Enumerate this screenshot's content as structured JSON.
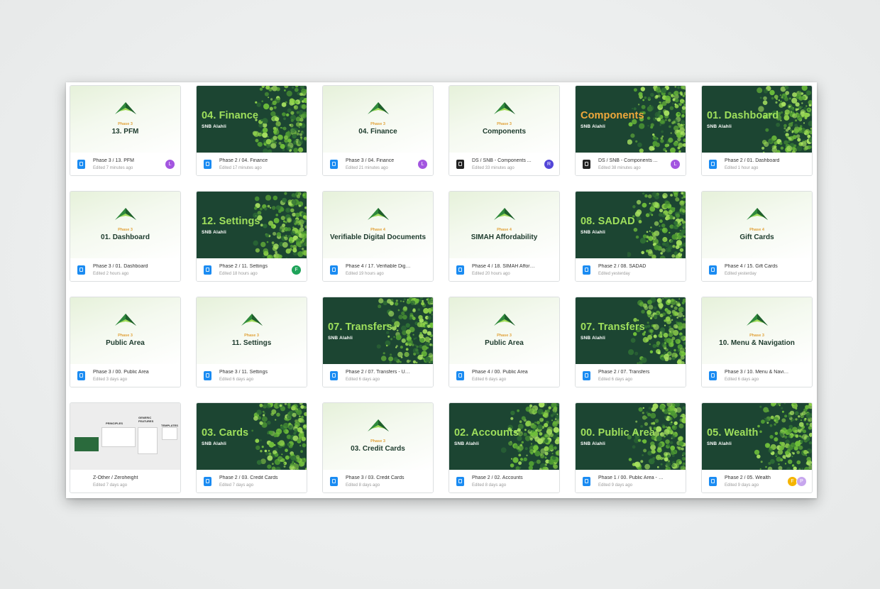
{
  "colors": {
    "dark_bg": "#1c4532",
    "accent_green": "#9fe05c",
    "accent_orange": "#f2a93b",
    "phase_label": "#e1a23a",
    "file_icon_blue": "#1a8bf2"
  },
  "files": [
    {
      "thumb": "light",
      "phase": "Phase 3",
      "title": "13. PFM",
      "name": "Phase 3 / 13. PFM",
      "edited": "Edited 7 minutes ago",
      "icon": "figma-file-icon",
      "icon_color": "blue",
      "avatars": [
        {
          "letter": "L",
          "color": "#a355e0"
        }
      ]
    },
    {
      "thumb": "dark",
      "title": "04. Finance",
      "brand": "SNB Alahli",
      "name": "Phase 2 / 04. Finance",
      "edited": "Edited 17 minutes ago",
      "icon": "figma-file-icon",
      "icon_color": "blue",
      "avatars": []
    },
    {
      "thumb": "light",
      "phase": "Phase 3",
      "title": "04. Finance",
      "name": "Phase 3 / 04. Finance",
      "edited": "Edited 21 minutes ago",
      "icon": "figma-file-icon",
      "icon_color": "blue",
      "avatars": [
        {
          "letter": "L",
          "color": "#a355e0"
        }
      ]
    },
    {
      "thumb": "light",
      "phase": "Phase 3",
      "title": "Components",
      "name": "DS / SNB - Components ...",
      "edited": "Edited 33 minutes ago",
      "icon": "library-file-icon",
      "icon_color": "black",
      "avatars": [
        {
          "letter": "R",
          "color": "#5346d8"
        }
      ]
    },
    {
      "thumb": "dark",
      "title": "Components",
      "title_color": "orange",
      "brand": "SNB Alahli",
      "name": "DS / SNB - Components ...",
      "edited": "Edited 38 minutes ago",
      "icon": "library-file-icon",
      "icon_color": "black",
      "avatars": [
        {
          "letter": "L",
          "color": "#a355e0"
        }
      ]
    },
    {
      "thumb": "dark",
      "title": "01. Dashboard",
      "brand": "SNB Alahli",
      "name": "Phase 2 / 01. Dashboard",
      "edited": "Edited 1 hour ago",
      "icon": "figma-file-icon",
      "icon_color": "blue",
      "avatars": []
    },
    {
      "thumb": "light",
      "phase": "Phase 3",
      "title": "01. Dashboard",
      "name": "Phase 3 / 01. Dashboard",
      "edited": "Edited 2 hours ago",
      "icon": "figma-file-icon",
      "icon_color": "blue",
      "avatars": []
    },
    {
      "thumb": "dark",
      "title": "12. Settings",
      "brand": "SNB Alahli",
      "name": "Phase 2 / 11. Settings",
      "edited": "Edited 18 hours ago",
      "icon": "figma-file-icon",
      "icon_color": "blue",
      "avatars": [
        {
          "letter": "F",
          "color": "#1fa35a"
        }
      ]
    },
    {
      "thumb": "light",
      "phase": "Phase 4",
      "title": "Verifiable Digital Documents",
      "name": "Phase 4 / 17. Verifiable Digital ...",
      "edited": "Edited 19 hours ago",
      "icon": "figma-file-icon",
      "icon_color": "blue",
      "avatars": []
    },
    {
      "thumb": "light",
      "phase": "Phase 4",
      "title": "SIMAH Affordability",
      "name": "Phase 4 / 18. SIMAH Affordab...",
      "edited": "Edited 20 hours ago",
      "icon": "figma-file-icon",
      "icon_color": "blue",
      "avatars": []
    },
    {
      "thumb": "dark",
      "title": "08. SADAD",
      "brand": "SNB Alahli",
      "name": "Phase 2 / 08. SADAD",
      "edited": "Edited yesterday",
      "icon": "figma-file-icon",
      "icon_color": "blue",
      "avatars": []
    },
    {
      "thumb": "light",
      "phase": "Phase 4",
      "title": "Gift Cards",
      "name": "Phase 4 / 15. Gift Cards",
      "edited": "Edited yesterday",
      "icon": "figma-file-icon",
      "icon_color": "blue",
      "avatars": []
    },
    {
      "thumb": "light",
      "phase": "Phase 3",
      "title": "Public Area",
      "name": "Phase 3 / 00. Public Area",
      "edited": "Edited 3 days ago",
      "icon": "figma-file-icon",
      "icon_color": "blue",
      "avatars": []
    },
    {
      "thumb": "light",
      "phase": "Phase 3",
      "title": "11. Settings",
      "name": "Phase 3 / 11. Settings",
      "edited": "Edited 6 days ago",
      "icon": "figma-file-icon",
      "icon_color": "blue",
      "avatars": []
    },
    {
      "thumb": "dark",
      "title": "07. Transfers",
      "brand": "SNB Alahli",
      "name": "Phase 2 / 07. Transfers - Upd...",
      "edited": "Edited 6 days ago",
      "icon": "figma-file-icon",
      "icon_color": "blue",
      "avatars": []
    },
    {
      "thumb": "light",
      "phase": "Phase 3",
      "title": "Public Area",
      "name": "Phase 4 / 00. Public Area",
      "edited": "Edited 6 days ago",
      "icon": "figma-file-icon",
      "icon_color": "blue",
      "avatars": []
    },
    {
      "thumb": "dark",
      "title": "07. Transfers",
      "brand": "SNB Alahli",
      "name": "Phase 2 / 07. Transfers",
      "edited": "Edited 6 days ago",
      "icon": "figma-file-icon",
      "icon_color": "blue",
      "avatars": []
    },
    {
      "thumb": "light",
      "phase": "Phase 3",
      "title": "10. Menu & Navigation",
      "name": "Phase 3 / 10. Menu & Navigati...",
      "edited": "Edited 6 days ago",
      "icon": "figma-file-icon",
      "icon_color": "blue",
      "avatars": []
    },
    {
      "thumb": "other",
      "zo_labels": [
        "PRINCIPLES",
        "GENERIC FEATURES",
        "TEMPLATES"
      ],
      "name": "Z-Other / Zeroheight",
      "edited": "Edited 7 days ago",
      "icon": "none",
      "icon_color": "none",
      "avatars": []
    },
    {
      "thumb": "dark",
      "title": "03. Cards",
      "brand": "SNB Alahli",
      "name": "Phase 2 / 03. Credit Cards",
      "edited": "Edited 7 days ago",
      "icon": "figma-file-icon",
      "icon_color": "blue",
      "avatars": []
    },
    {
      "thumb": "light",
      "phase": "Phase 3",
      "title": "03. Credit Cards",
      "name": "Phase 3 / 03. Credit Cards",
      "edited": "Edited 8 days ago",
      "icon": "figma-file-icon",
      "icon_color": "blue",
      "avatars": []
    },
    {
      "thumb": "dark",
      "title": "02. Accounts",
      "brand": "SNB Alahli",
      "name": "Phase 2 / 02. Accounts",
      "edited": "Edited 8 days ago",
      "icon": "figma-file-icon",
      "icon_color": "blue",
      "avatars": []
    },
    {
      "thumb": "dark",
      "title": "00. Public Area",
      "brand": "SNB Alahli",
      "name": "Phase 1 / 00. Public Area - Up...",
      "edited": "Edited 9 days ago",
      "icon": "figma-file-icon",
      "icon_color": "blue",
      "avatars": []
    },
    {
      "thumb": "dark",
      "title": "05. Wealth",
      "brand": "SNB Alahli",
      "name": "Phase 2 / 05. Wealth",
      "edited": "Edited 9 days ago",
      "icon": "figma-file-icon",
      "icon_color": "blue",
      "avatars": [
        {
          "letter": "F",
          "color": "#f5b400"
        },
        {
          "letter": "P",
          "color": "#c7a6ee"
        }
      ]
    }
  ]
}
